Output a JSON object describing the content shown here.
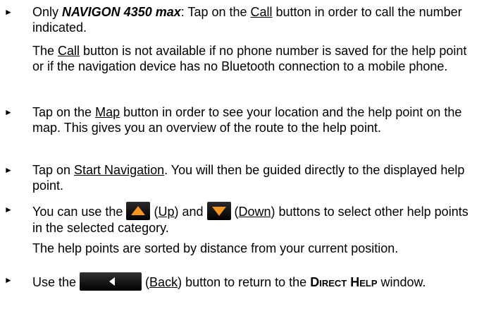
{
  "items": [
    {
      "pre": "Only ",
      "emph": "NAVIGON 4350 max",
      "mid1": ": Tap on the ",
      "link": "Call",
      "post": " button in order to call the number indicated.",
      "note_pre": "The ",
      "note_link": "Call",
      "note_post": " button is not available if no phone number is saved for the help point or if the navigation device has no Bluetooth connection to a mobile phone."
    },
    {
      "pre": "Tap on the ",
      "link": "Map",
      "post": " button in order to see your location and the help point on the map. This gives you an overview of the route to the help point."
    },
    {
      "pre": "Tap on ",
      "link": "Start Navigation",
      "post": ". You will then be guided directly to the displayed help point."
    },
    {
      "pre": "You can use the ",
      "up_paren_open": " (",
      "up_link": "Up",
      "mid": ") and ",
      "down_paren_open": " (",
      "down_link": "Down",
      "post": ") buttons to select other help points in the selected category.",
      "note": "The help points are sorted by distance from your current position."
    },
    {
      "pre": "Use the ",
      "paren_open": " (",
      "link": "Back",
      "mid": ") button to return to the ",
      "window_name": "Direct Help",
      "post": " window."
    }
  ],
  "bullet_glyph": "►",
  "icons": {
    "up": "up-arrow-icon",
    "down": "down-arrow-icon",
    "back": "back-arrow-icon"
  },
  "colors": {
    "arrow_orange": "#f7941d",
    "icon_background": "#000000"
  }
}
